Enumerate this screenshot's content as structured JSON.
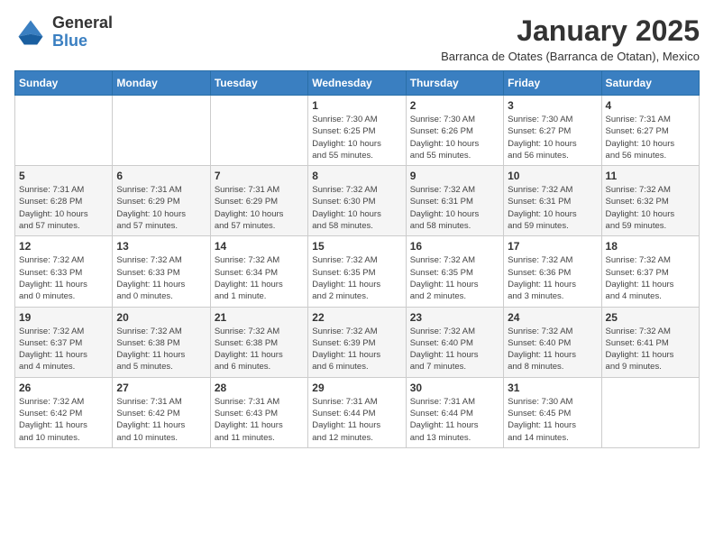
{
  "logo": {
    "general": "General",
    "blue": "Blue"
  },
  "title": "January 2025",
  "subtitle": "Barranca de Otates (Barranca de Otatan), Mexico",
  "days_of_week": [
    "Sunday",
    "Monday",
    "Tuesday",
    "Wednesday",
    "Thursday",
    "Friday",
    "Saturday"
  ],
  "weeks": [
    [
      {
        "day": "",
        "info": ""
      },
      {
        "day": "",
        "info": ""
      },
      {
        "day": "",
        "info": ""
      },
      {
        "day": "1",
        "info": "Sunrise: 7:30 AM\nSunset: 6:25 PM\nDaylight: 10 hours\nand 55 minutes."
      },
      {
        "day": "2",
        "info": "Sunrise: 7:30 AM\nSunset: 6:26 PM\nDaylight: 10 hours\nand 55 minutes."
      },
      {
        "day": "3",
        "info": "Sunrise: 7:30 AM\nSunset: 6:27 PM\nDaylight: 10 hours\nand 56 minutes."
      },
      {
        "day": "4",
        "info": "Sunrise: 7:31 AM\nSunset: 6:27 PM\nDaylight: 10 hours\nand 56 minutes."
      }
    ],
    [
      {
        "day": "5",
        "info": "Sunrise: 7:31 AM\nSunset: 6:28 PM\nDaylight: 10 hours\nand 57 minutes."
      },
      {
        "day": "6",
        "info": "Sunrise: 7:31 AM\nSunset: 6:29 PM\nDaylight: 10 hours\nand 57 minutes."
      },
      {
        "day": "7",
        "info": "Sunrise: 7:31 AM\nSunset: 6:29 PM\nDaylight: 10 hours\nand 57 minutes."
      },
      {
        "day": "8",
        "info": "Sunrise: 7:32 AM\nSunset: 6:30 PM\nDaylight: 10 hours\nand 58 minutes."
      },
      {
        "day": "9",
        "info": "Sunrise: 7:32 AM\nSunset: 6:31 PM\nDaylight: 10 hours\nand 58 minutes."
      },
      {
        "day": "10",
        "info": "Sunrise: 7:32 AM\nSunset: 6:31 PM\nDaylight: 10 hours\nand 59 minutes."
      },
      {
        "day": "11",
        "info": "Sunrise: 7:32 AM\nSunset: 6:32 PM\nDaylight: 10 hours\nand 59 minutes."
      }
    ],
    [
      {
        "day": "12",
        "info": "Sunrise: 7:32 AM\nSunset: 6:33 PM\nDaylight: 11 hours\nand 0 minutes."
      },
      {
        "day": "13",
        "info": "Sunrise: 7:32 AM\nSunset: 6:33 PM\nDaylight: 11 hours\nand 0 minutes."
      },
      {
        "day": "14",
        "info": "Sunrise: 7:32 AM\nSunset: 6:34 PM\nDaylight: 11 hours\nand 1 minute."
      },
      {
        "day": "15",
        "info": "Sunrise: 7:32 AM\nSunset: 6:35 PM\nDaylight: 11 hours\nand 2 minutes."
      },
      {
        "day": "16",
        "info": "Sunrise: 7:32 AM\nSunset: 6:35 PM\nDaylight: 11 hours\nand 2 minutes."
      },
      {
        "day": "17",
        "info": "Sunrise: 7:32 AM\nSunset: 6:36 PM\nDaylight: 11 hours\nand 3 minutes."
      },
      {
        "day": "18",
        "info": "Sunrise: 7:32 AM\nSunset: 6:37 PM\nDaylight: 11 hours\nand 4 minutes."
      }
    ],
    [
      {
        "day": "19",
        "info": "Sunrise: 7:32 AM\nSunset: 6:37 PM\nDaylight: 11 hours\nand 4 minutes."
      },
      {
        "day": "20",
        "info": "Sunrise: 7:32 AM\nSunset: 6:38 PM\nDaylight: 11 hours\nand 5 minutes."
      },
      {
        "day": "21",
        "info": "Sunrise: 7:32 AM\nSunset: 6:38 PM\nDaylight: 11 hours\nand 6 minutes."
      },
      {
        "day": "22",
        "info": "Sunrise: 7:32 AM\nSunset: 6:39 PM\nDaylight: 11 hours\nand 6 minutes."
      },
      {
        "day": "23",
        "info": "Sunrise: 7:32 AM\nSunset: 6:40 PM\nDaylight: 11 hours\nand 7 minutes."
      },
      {
        "day": "24",
        "info": "Sunrise: 7:32 AM\nSunset: 6:40 PM\nDaylight: 11 hours\nand 8 minutes."
      },
      {
        "day": "25",
        "info": "Sunrise: 7:32 AM\nSunset: 6:41 PM\nDaylight: 11 hours\nand 9 minutes."
      }
    ],
    [
      {
        "day": "26",
        "info": "Sunrise: 7:32 AM\nSunset: 6:42 PM\nDaylight: 11 hours\nand 10 minutes."
      },
      {
        "day": "27",
        "info": "Sunrise: 7:31 AM\nSunset: 6:42 PM\nDaylight: 11 hours\nand 10 minutes."
      },
      {
        "day": "28",
        "info": "Sunrise: 7:31 AM\nSunset: 6:43 PM\nDaylight: 11 hours\nand 11 minutes."
      },
      {
        "day": "29",
        "info": "Sunrise: 7:31 AM\nSunset: 6:44 PM\nDaylight: 11 hours\nand 12 minutes."
      },
      {
        "day": "30",
        "info": "Sunrise: 7:31 AM\nSunset: 6:44 PM\nDaylight: 11 hours\nand 13 minutes."
      },
      {
        "day": "31",
        "info": "Sunrise: 7:30 AM\nSunset: 6:45 PM\nDaylight: 11 hours\nand 14 minutes."
      },
      {
        "day": "",
        "info": ""
      }
    ]
  ]
}
